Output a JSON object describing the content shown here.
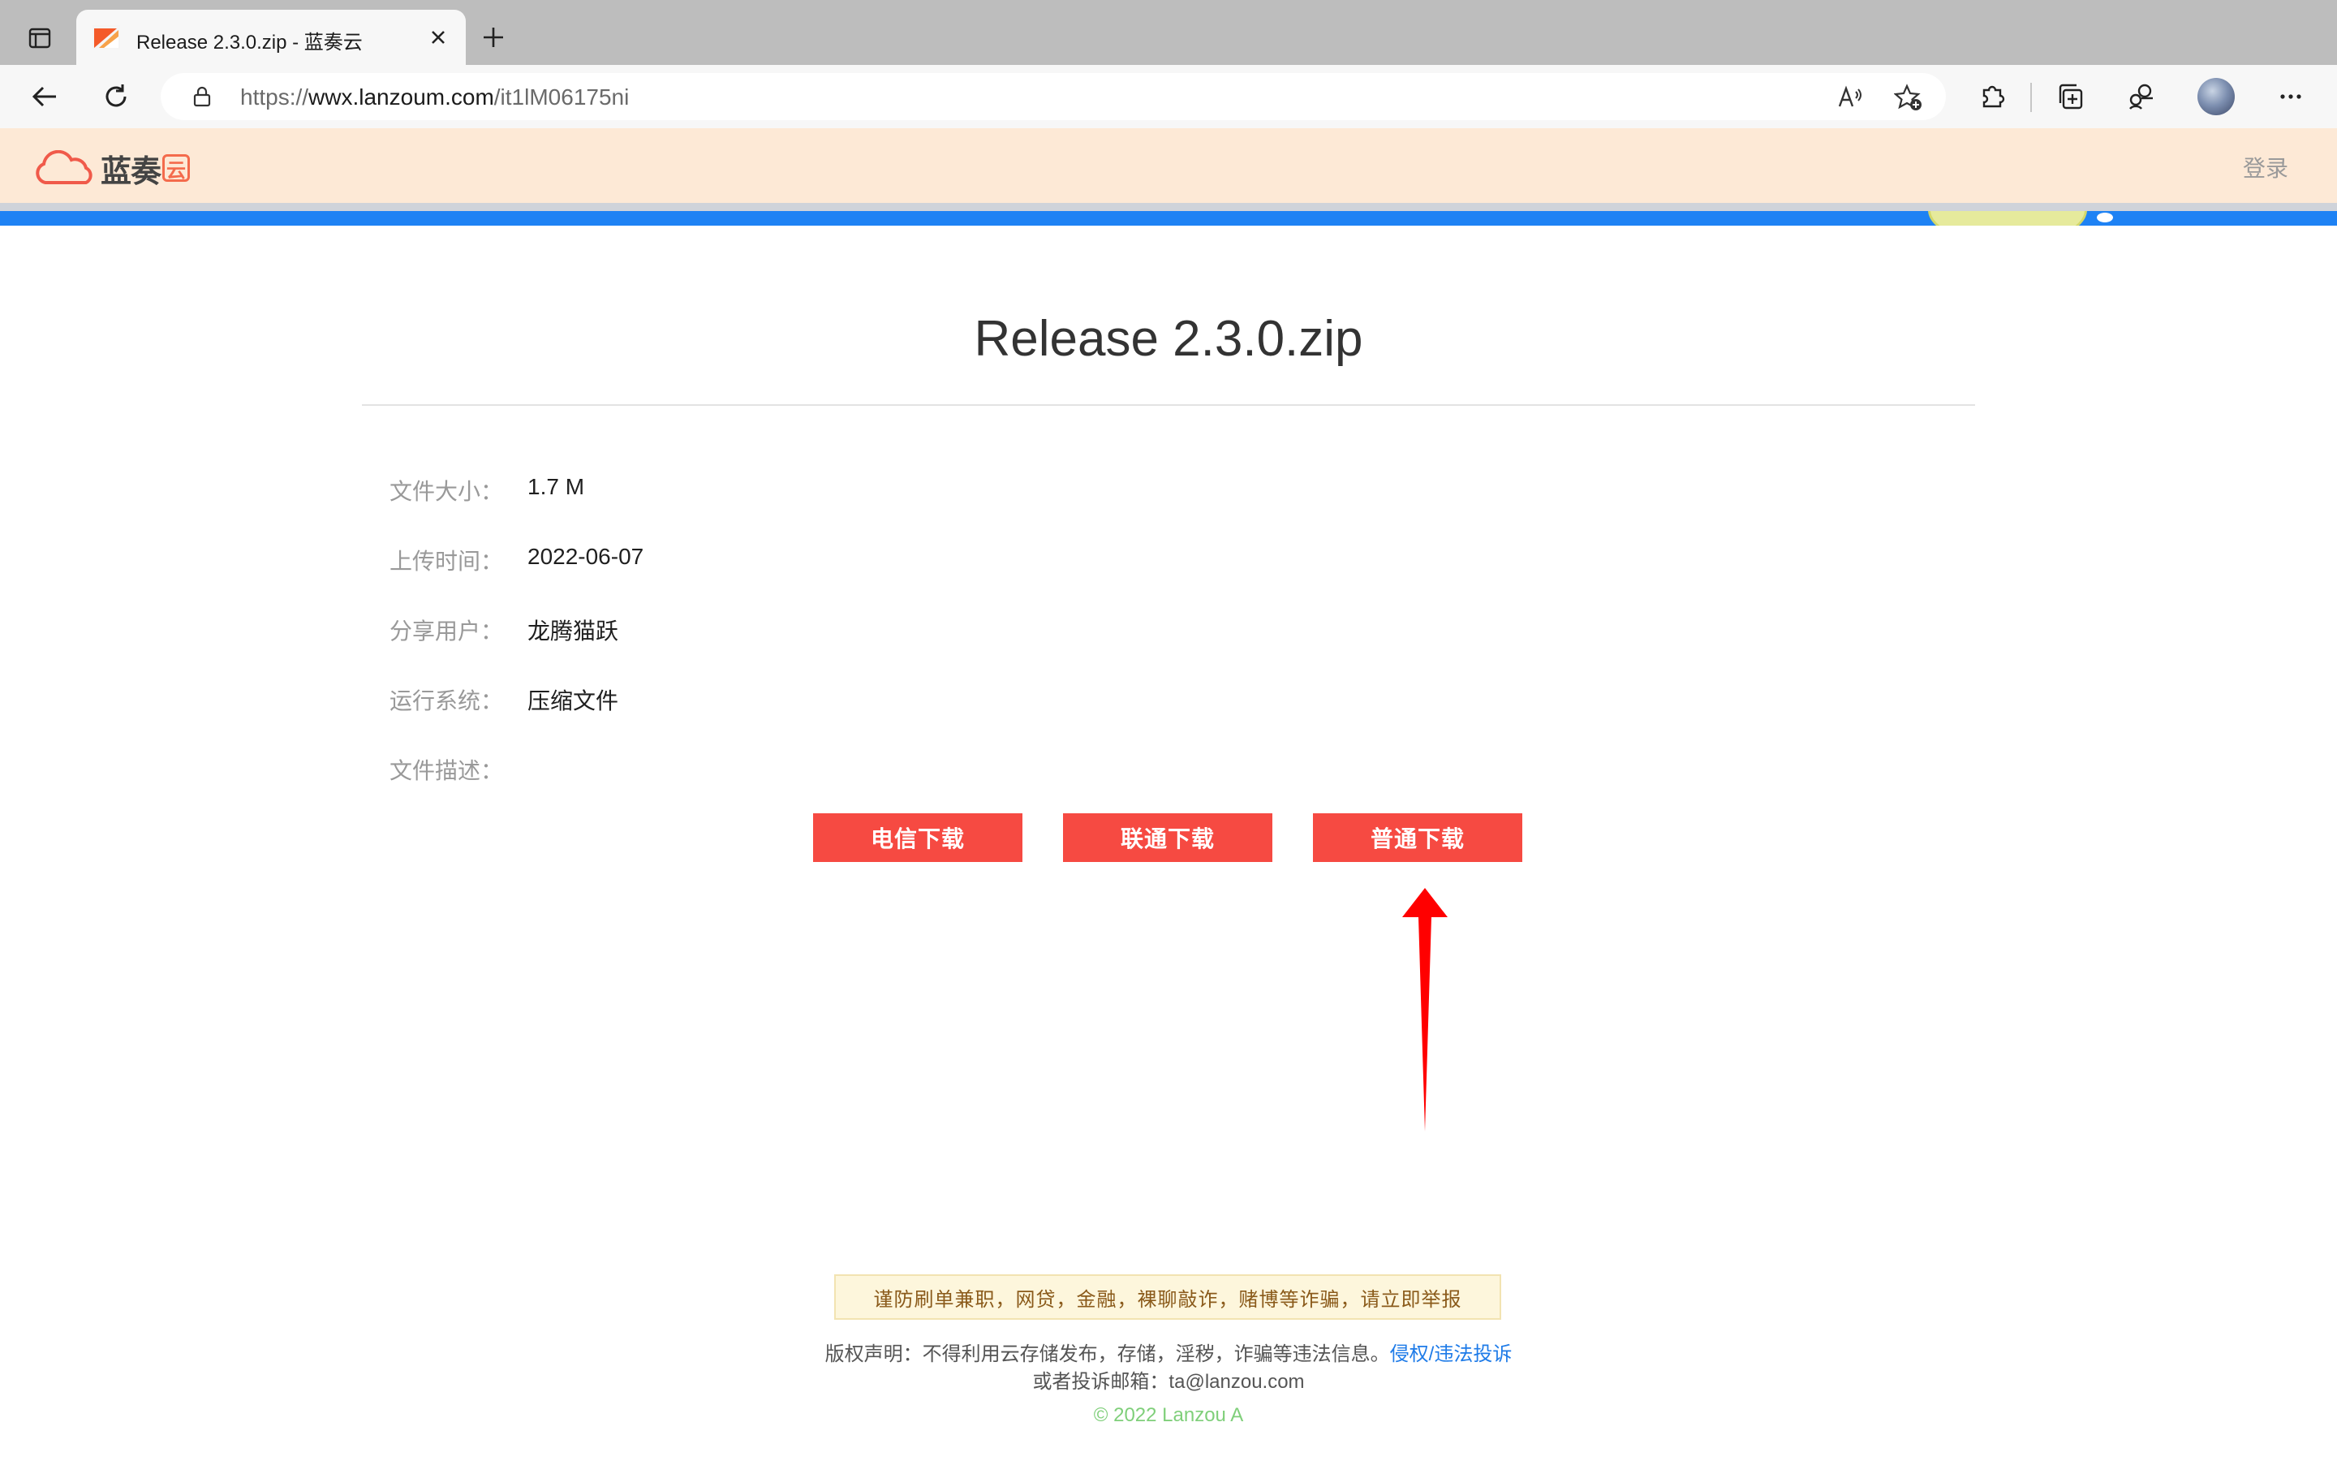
{
  "browser": {
    "tab_title": "Release 2.3.0.zip - 蓝奏云",
    "url_prefix": "https://",
    "url_host": "wwx.lanzoum.com",
    "url_path": "/it1lM06175ni"
  },
  "site": {
    "logo_text": "蓝奏",
    "logo_badge": "云",
    "login_label": "登录"
  },
  "file": {
    "title": "Release 2.3.0.zip",
    "fields": [
      {
        "label": "文件大小：",
        "value": "1.7 M"
      },
      {
        "label": "上传时间：",
        "value": "2022-06-07"
      },
      {
        "label": "分享用户：",
        "value": "龙腾猫跃"
      },
      {
        "label": "运行系统：",
        "value": "压缩文件"
      },
      {
        "label": "文件描述：",
        "value": ""
      }
    ]
  },
  "downloads": {
    "telecom": "电信下载",
    "unicom": "联通下载",
    "normal": "普通下载"
  },
  "footer": {
    "warning": "谨防刷单兼职，网贷，金融，裸聊敲诈，赌博等诈骗，请立即举报",
    "copyright_text": "版权声明：不得利用云存储发布，存储，淫秽，诈骗等违法信息。",
    "copyright_link": "侵权/违法投诉",
    "complaint_email": "或者投诉邮箱：ta@lanzou.com",
    "year_line": "© 2022 Lanzou A"
  },
  "colors": {
    "download_button": "#f64a42",
    "header_bg": "#fde9d6",
    "banner": "#1e82f4",
    "annotation_arrow": "#ff0000"
  }
}
